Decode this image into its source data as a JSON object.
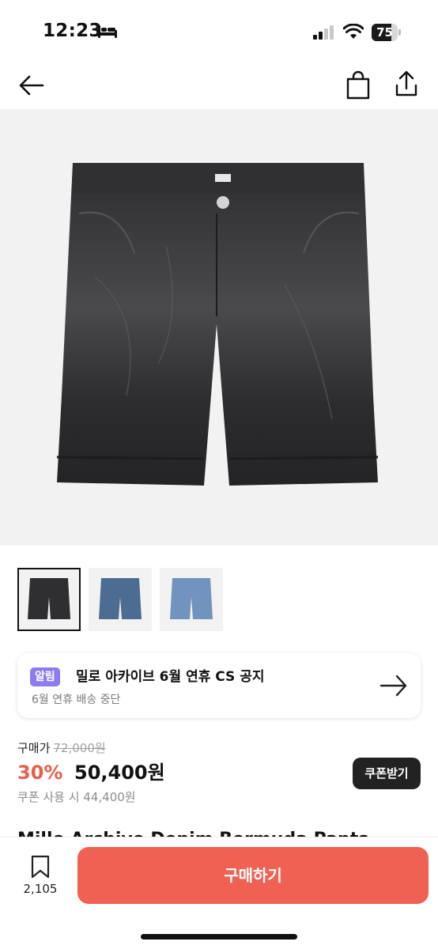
{
  "status_bar": {
    "time": "12:23",
    "battery": "75",
    "battery_level": 0.75
  },
  "notice": {
    "badge": "알림",
    "title": "밀로 아카이브 6월 연휴 CS 공지",
    "subtitle": "6월 연휴 배송 중단"
  },
  "price": {
    "label": "구매가",
    "original": "72,000원",
    "discount": "30%",
    "sale": "50,400원",
    "coupon_price": "쿠폰 사용 시 44,400원",
    "coupon_button": "쿠폰받기"
  },
  "product": {
    "title_partial": "Millo Archive Denim Bermuda Pants"
  },
  "bottom_bar": {
    "wish_count": "2,105",
    "buy_button": "구매하기"
  },
  "colors": {
    "accent": "#ef6152",
    "badge": "#8f7bf0"
  }
}
